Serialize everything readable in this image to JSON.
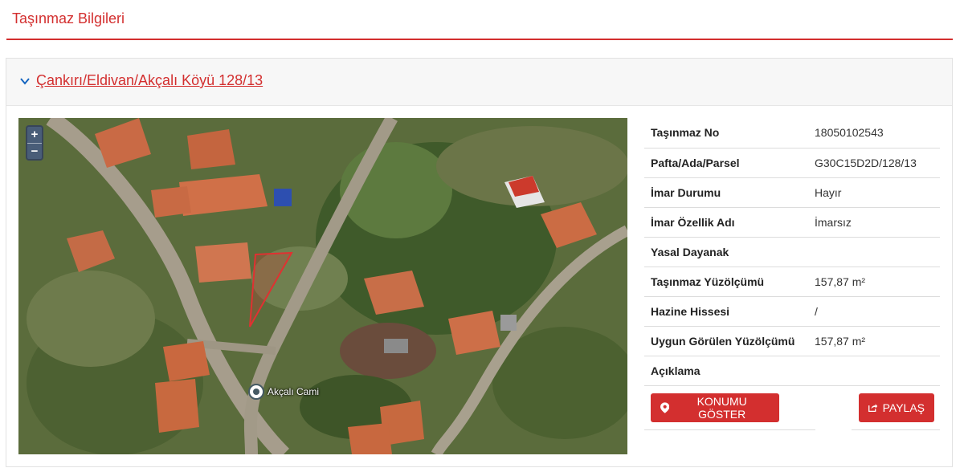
{
  "page": {
    "title": "Taşınmaz Bilgileri"
  },
  "panel": {
    "heading_link": "Çankırı/Eldivan/Akçalı Köyü 128/13"
  },
  "map": {
    "zoom_in": "+",
    "zoom_out": "−",
    "poi_label": "Akçalı Cami"
  },
  "info": {
    "rows": [
      {
        "key": "Taşınmaz No",
        "value": "18050102543"
      },
      {
        "key": "Pafta/Ada/Parsel",
        "value": "G30C15D2D/128/13"
      },
      {
        "key": "İmar Durumu",
        "value": "Hayır"
      },
      {
        "key": "İmar Özellik Adı",
        "value": "İmarsız"
      },
      {
        "key": "Yasal Dayanak",
        "value": ""
      },
      {
        "key": "Taşınmaz Yüzölçümü",
        "value": "157,87 m²"
      },
      {
        "key": "Hazine Hissesi",
        "value": "/"
      },
      {
        "key": "Uygun Görülen Yüzölçümü",
        "value": "157,87 m²"
      },
      {
        "key": "Açıklama",
        "value": ""
      }
    ]
  },
  "actions": {
    "show_location": "KONUMU GÖSTER",
    "share": "PAYLAŞ"
  },
  "colors": {
    "accent": "#d32f2f",
    "header_bg": "#f7f7f7",
    "border": "#dcdcdc"
  },
  "icons": {
    "chevron": "chevron-down-icon",
    "location": "map-marker-icon",
    "share": "share-icon",
    "poi": "place-pin-icon"
  }
}
